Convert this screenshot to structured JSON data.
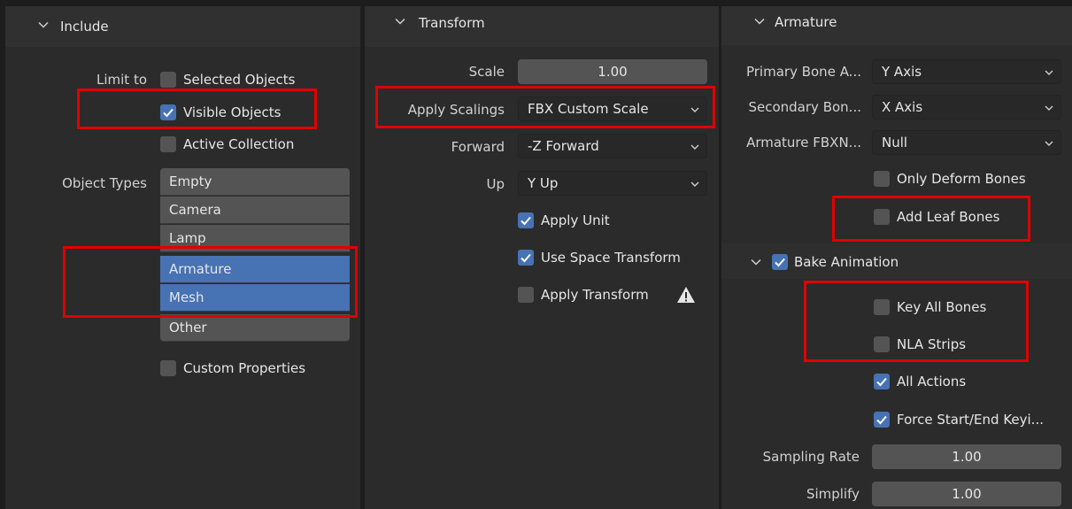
{
  "include": {
    "title": "Include",
    "limit_to_label": "Limit to",
    "limit_to": [
      {
        "label": "Selected Objects",
        "checked": false
      },
      {
        "label": "Visible Objects",
        "checked": true
      },
      {
        "label": "Active Collection",
        "checked": false
      }
    ],
    "object_types_label": "Object Types",
    "object_types": [
      {
        "label": "Empty",
        "selected": false
      },
      {
        "label": "Camera",
        "selected": false
      },
      {
        "label": "Lamp",
        "selected": false
      },
      {
        "label": "Armature",
        "selected": true
      },
      {
        "label": "Mesh",
        "selected": true
      },
      {
        "label": "Other",
        "selected": false
      }
    ],
    "custom_properties": {
      "label": "Custom Properties",
      "checked": false
    }
  },
  "transform": {
    "title": "Transform",
    "scale_label": "Scale",
    "scale_value": "1.00",
    "apply_scalings_label": "Apply Scalings",
    "apply_scalings_value": "FBX Custom Scale",
    "forward_label": "Forward",
    "forward_value": "-Z Forward",
    "up_label": "Up",
    "up_value": "Y Up",
    "apply_unit": {
      "label": "Apply Unit",
      "checked": true
    },
    "use_space_transform": {
      "label": "Use Space Transform",
      "checked": true
    },
    "apply_transform": {
      "label": "Apply Transform",
      "checked": false
    }
  },
  "armature": {
    "title": "Armature",
    "primary_bone_label": "Primary Bone A...",
    "primary_bone_value": "Y Axis",
    "secondary_bone_label": "Secondary Bon...",
    "secondary_bone_value": "X Axis",
    "armature_fbxnode_label": "Armature FBXN...",
    "armature_fbxnode_value": "Null",
    "only_deform_bones": {
      "label": "Only Deform Bones",
      "checked": false
    },
    "add_leaf_bones": {
      "label": "Add Leaf Bones",
      "checked": false
    }
  },
  "bake_animation": {
    "title": "Bake Animation",
    "checked": true,
    "key_all_bones": {
      "label": "Key All Bones",
      "checked": false
    },
    "nla_strips": {
      "label": "NLA Strips",
      "checked": false
    },
    "all_actions": {
      "label": "All Actions",
      "checked": true
    },
    "force_start_end": {
      "label": "Force Start/End Keyi...",
      "checked": true
    },
    "sampling_rate_label": "Sampling Rate",
    "sampling_rate_value": "1.00",
    "simplify_label": "Simplify",
    "simplify_value": "1.00"
  },
  "colors": {
    "background": "#2b2b2b",
    "header": "#303030",
    "field": "#545454",
    "selected": "#4772b3",
    "highlight": "#e00000"
  }
}
